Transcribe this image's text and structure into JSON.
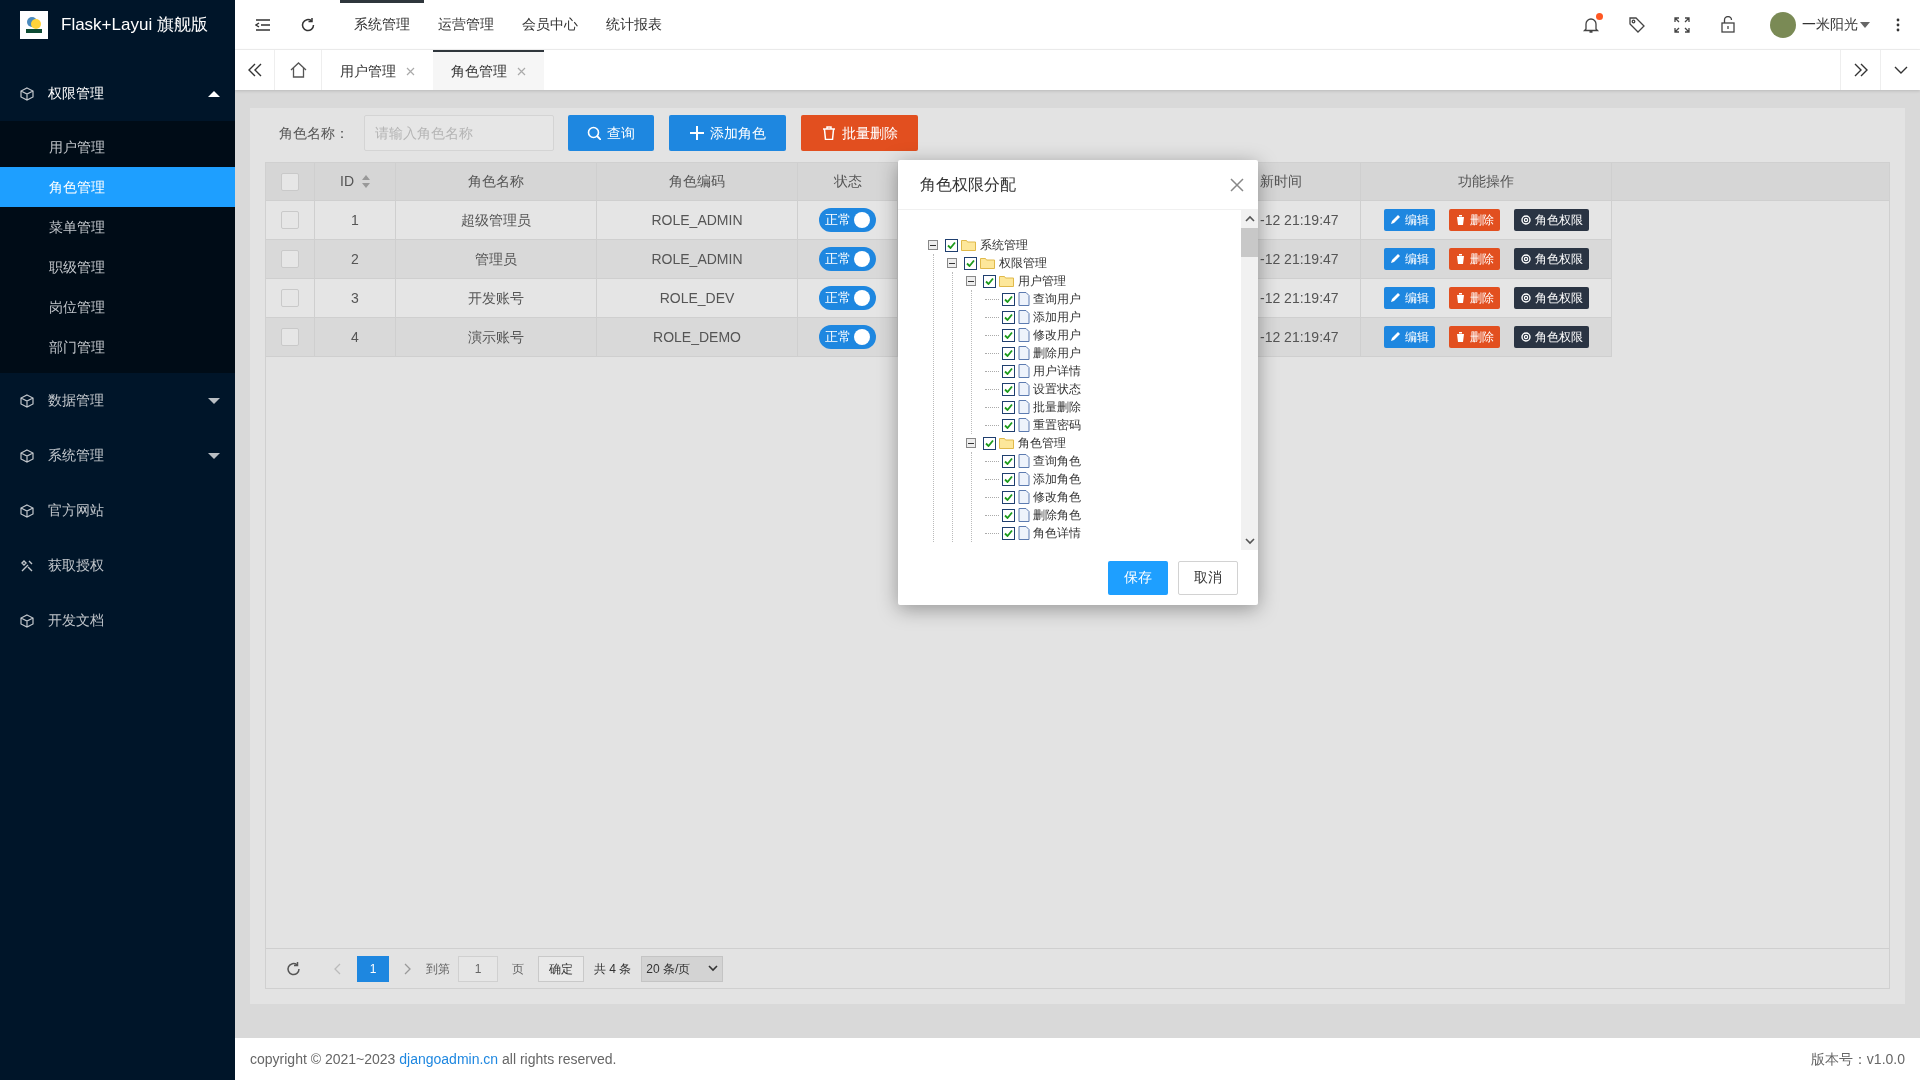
{
  "app": {
    "title": "Flask+Layui 旗舰版"
  },
  "sidebar": {
    "items": [
      {
        "label": "权限管理",
        "kind": "group",
        "expanded": true,
        "children": [
          {
            "label": "用户管理",
            "selected": false
          },
          {
            "label": "角色管理",
            "selected": true
          },
          {
            "label": "菜单管理",
            "selected": false
          },
          {
            "label": "职级管理",
            "selected": false
          },
          {
            "label": "岗位管理",
            "selected": false
          },
          {
            "label": "部门管理",
            "selected": false
          }
        ]
      },
      {
        "label": "数据管理",
        "kind": "group",
        "expanded": false
      },
      {
        "label": "系统管理",
        "kind": "group",
        "expanded": false
      },
      {
        "label": "官方网站",
        "kind": "link"
      },
      {
        "label": "获取授权",
        "kind": "link"
      },
      {
        "label": "开发文档",
        "kind": "link"
      }
    ]
  },
  "top_nav": [
    {
      "label": "系统管理",
      "selected": true
    },
    {
      "label": "运营管理",
      "selected": false
    },
    {
      "label": "会员中心",
      "selected": false
    },
    {
      "label": "统计报表",
      "selected": false
    }
  ],
  "header_right": {
    "notification_dot": true,
    "user": "一米阳光"
  },
  "tabs": [
    {
      "label": "用户管理",
      "selected": false
    },
    {
      "label": "角色管理",
      "selected": true
    }
  ],
  "search": {
    "label": "角色名称：",
    "placeholder": "请输入角色名称",
    "buttons": [
      {
        "label": "查询",
        "kind": "query"
      },
      {
        "label": "添加角色",
        "kind": "add"
      },
      {
        "label": "批量删除",
        "kind": "delete"
      }
    ]
  },
  "table": {
    "select_all_checked": false,
    "columns": [
      {
        "label": "ID",
        "sortable": true
      },
      {
        "label": "角色名称",
        "sortable": false
      },
      {
        "label": "角色编码",
        "sortable": false
      },
      {
        "label": "状态",
        "sortable": false
      },
      {
        "label": "新时间",
        "sortable": false
      },
      {
        "label": "功能操作",
        "sortable": false
      }
    ],
    "rows": [
      {
        "checked": false,
        "id": "1",
        "name": "超级管理员",
        "code": "ROLE_ADMIN",
        "status": "正常",
        "status_on": true,
        "time": "-12 21:19:47",
        "actions": [
          "编辑",
          "删除",
          "角色权限"
        ]
      },
      {
        "checked": false,
        "id": "2",
        "name": "管理员",
        "code": "ROLE_ADMIN",
        "status": "正常",
        "status_on": true,
        "time": "-12 21:19:47",
        "actions": [
          "编辑",
          "删除",
          "角色权限"
        ]
      },
      {
        "checked": false,
        "id": "3",
        "name": "开发账号",
        "code": "ROLE_DEV",
        "status": "正常",
        "status_on": true,
        "time": "-12 21:19:47",
        "actions": [
          "编辑",
          "删除",
          "角色权限"
        ]
      },
      {
        "checked": false,
        "id": "4",
        "name": "演示账号",
        "code": "ROLE_DEMO",
        "status": "正常",
        "status_on": true,
        "time": "-12 21:19:47",
        "actions": [
          "编辑",
          "删除",
          "角色权限"
        ]
      }
    ]
  },
  "modal": {
    "title": "角色权限分配",
    "buttons": [
      "保存",
      "取消"
    ],
    "tree": [
      {
        "label": "系统管理",
        "kind": "folder",
        "expanded": true,
        "checked": true,
        "children": [
          {
            "label": "权限管理",
            "kind": "folder",
            "expanded": true,
            "checked": true,
            "children": [
              {
                "label": "用户管理",
                "kind": "folder",
                "expanded": true,
                "checked": true,
                "children": [
                  {
                    "label": "查询用户",
                    "kind": "file",
                    "checked": true
                  },
                  {
                    "label": "添加用户",
                    "kind": "file",
                    "checked": true
                  },
                  {
                    "label": "修改用户",
                    "kind": "file",
                    "checked": true
                  },
                  {
                    "label": "删除用户",
                    "kind": "file",
                    "checked": true
                  },
                  {
                    "label": "用户详情",
                    "kind": "file",
                    "checked": true
                  },
                  {
                    "label": "设置状态",
                    "kind": "file",
                    "checked": true
                  },
                  {
                    "label": "批量删除",
                    "kind": "file",
                    "checked": true
                  },
                  {
                    "label": "重置密码",
                    "kind": "file",
                    "checked": true
                  }
                ]
              },
              {
                "label": "角色管理",
                "kind": "folder",
                "expanded": true,
                "checked": true,
                "children": [
                  {
                    "label": "查询角色",
                    "kind": "file",
                    "checked": true
                  },
                  {
                    "label": "添加角色",
                    "kind": "file",
                    "checked": true
                  },
                  {
                    "label": "修改角色",
                    "kind": "file",
                    "checked": true
                  },
                  {
                    "label": "删除角色",
                    "kind": "file",
                    "checked": true
                  },
                  {
                    "label": "角色详情",
                    "kind": "file",
                    "checked": true
                  }
                ]
              }
            ]
          }
        ]
      }
    ]
  },
  "pagination": {
    "current": "1",
    "goto_label": "到第",
    "goto_value": "1",
    "page_unit": "页",
    "confirm": "确定",
    "total": "共 4 条",
    "page_size": "20 条/页"
  },
  "footer": {
    "copyright_before": "copyright © 2021~2023",
    "link": "djangoadmin.cn",
    "copyright_after": "all rights reserved.",
    "version": "版本号：v1.0.0"
  }
}
